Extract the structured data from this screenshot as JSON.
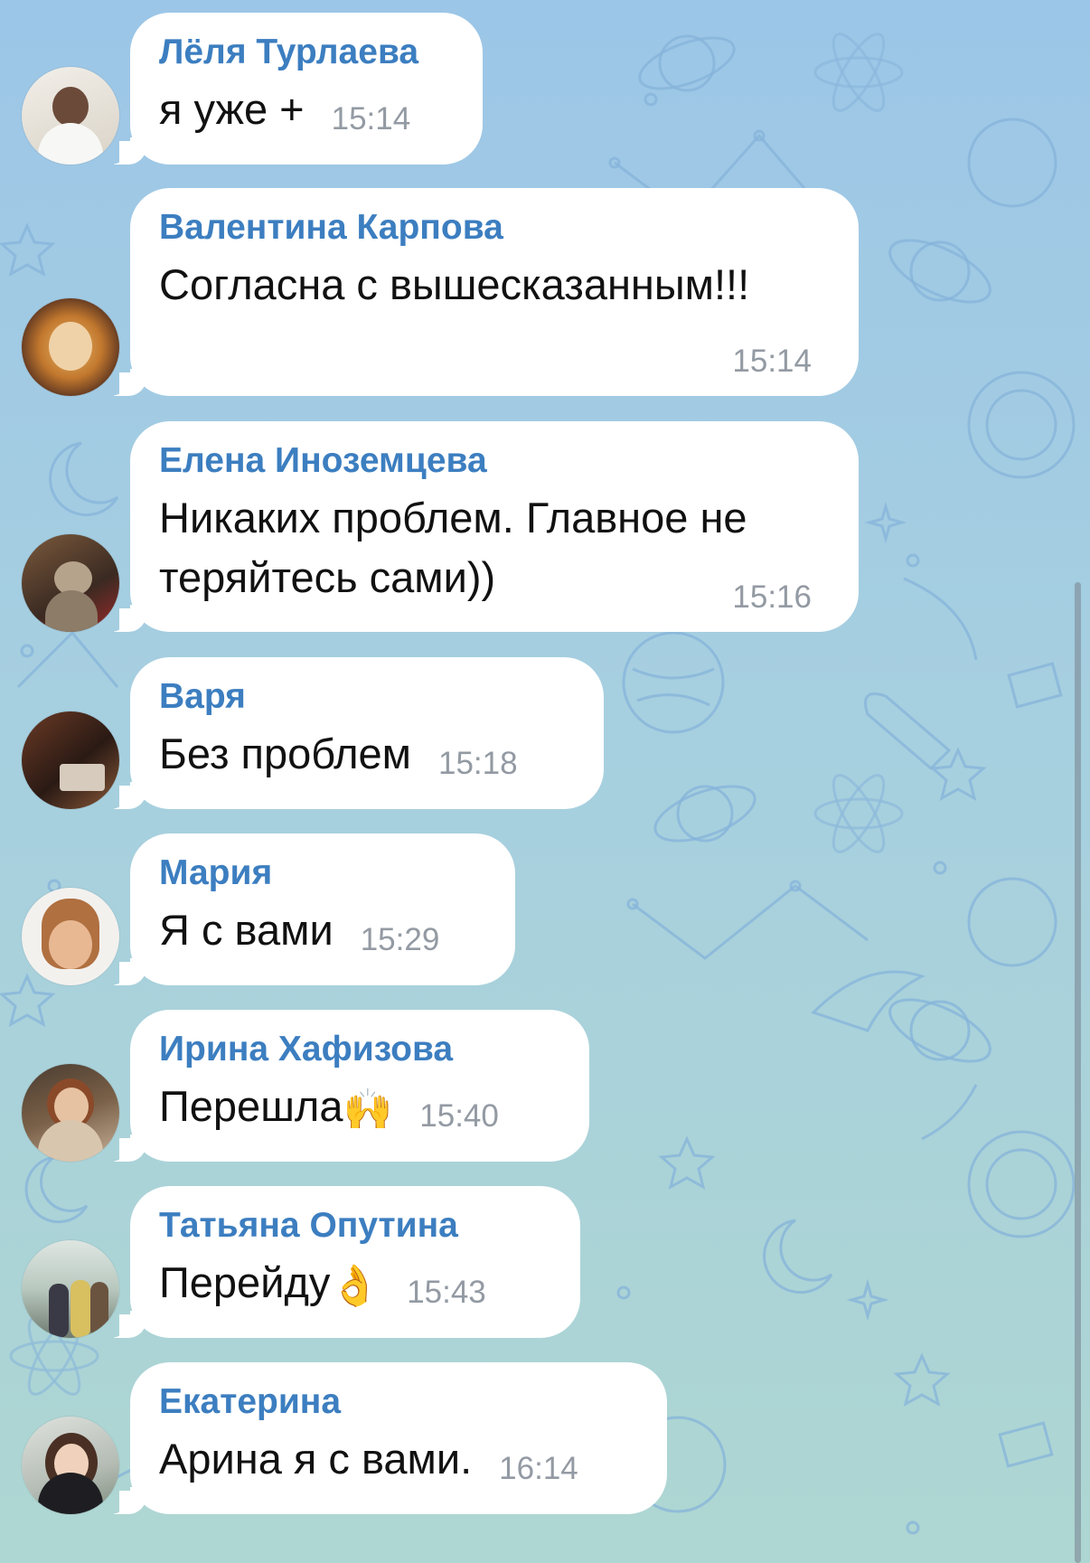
{
  "messages": [
    {
      "sender": "Лёля Турлаева",
      "text": "я уже +",
      "time": "15:14",
      "emoji": "",
      "sender_color": "#3c7ec0",
      "avatar": "photo-woman-white-sweater"
    },
    {
      "sender": "Валентина Карпова",
      "text": "Согласна с вышесказанным!!!",
      "time": "15:14",
      "emoji": "",
      "sender_color": "#3c7ec0",
      "avatar": "photo-sun-face-art"
    },
    {
      "sender": "Елена Иноземцева",
      "text": "Никаких проблем. Главное не",
      "text2": "теряйтесь сами))",
      "time": "15:16",
      "emoji": "",
      "sender_color": "#3c7ec0",
      "avatar": "photo-kitten"
    },
    {
      "sender": "Варя",
      "text": "Без проблем",
      "time": "15:18",
      "emoji": "",
      "sender_color": "#3c7ec0",
      "avatar": "photo-restaurant-interior"
    },
    {
      "sender": "Мария",
      "text": "Я с вами",
      "time": "15:29",
      "emoji": "",
      "sender_color": "#3c7ec0",
      "avatar": "photo-cartoon-girl"
    },
    {
      "sender": "Ирина Хафизова",
      "text": "Перешла",
      "time": "15:40",
      "emoji": "🙌",
      "sender_color": "#3c7ec0",
      "avatar": "photo-woman-christmas-lights"
    },
    {
      "sender": "Татьяна Опутина",
      "text": "Перейду",
      "time": "15:43",
      "emoji": "👌",
      "sender_color": "#3c7ec0",
      "avatar": "photo-group-of-people"
    },
    {
      "sender": "Екатерина",
      "text": "Арина я с вами.",
      "time": "16:14",
      "emoji": "",
      "sender_color": "#3c7ec0",
      "avatar": "photo-woman-portrait"
    }
  ],
  "colors": {
    "bubble": "#ffffff",
    "timestamp": "#939aa3",
    "message_text": "#111111",
    "background": "#a6cfe0"
  }
}
